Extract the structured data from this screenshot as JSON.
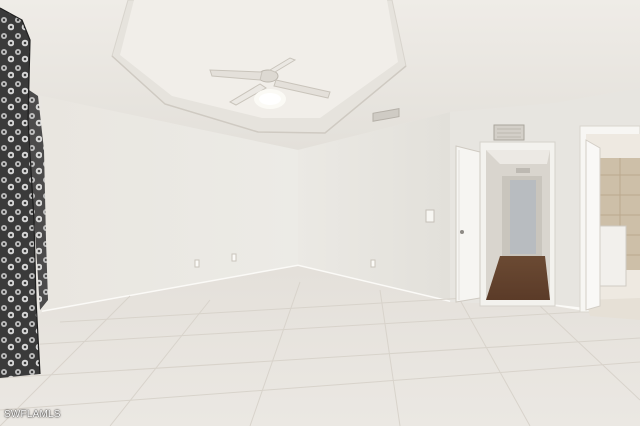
{
  "photo": {
    "watermark": "SWFLAMLS"
  }
}
